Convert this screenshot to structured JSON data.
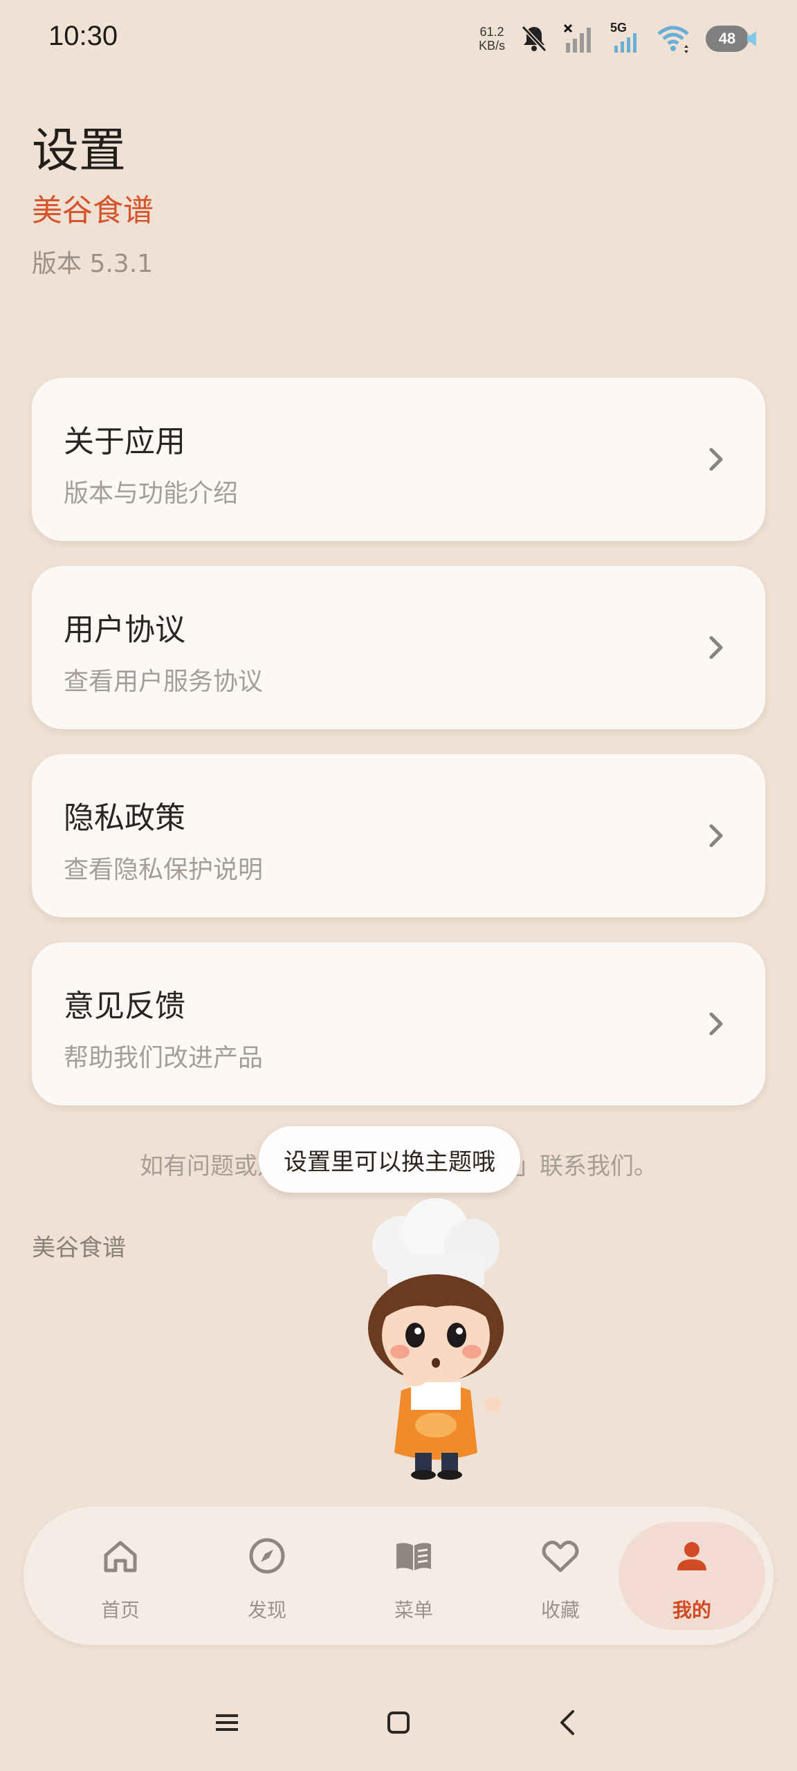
{
  "status_bar": {
    "time": "10:30",
    "net_speed_value": "61.2",
    "net_speed_unit": "KB/s",
    "network_type": "5G",
    "battery": "48",
    "icons": [
      "mute-bell-icon",
      "signal-no-service-icon",
      "signal-5g-icon",
      "wifi-icon",
      "battery-icon"
    ]
  },
  "header": {
    "title": "设置",
    "app_name": "美谷食谱",
    "version": "版本 5.3.1"
  },
  "menu": {
    "items": [
      {
        "title": "关于应用",
        "subtitle": "版本与功能介绍"
      },
      {
        "title": "用户协议",
        "subtitle": "查看用户服务协议"
      },
      {
        "title": "隐私政策",
        "subtitle": "查看隐私保护说明"
      },
      {
        "title": "意见反馈",
        "subtitle": "帮助我们改进产品"
      }
    ]
  },
  "footer": {
    "contact_text": "如有问题或建议，请通过「意见反馈」联系我们。",
    "tooltip": "设置里可以换主题哦",
    "brand": "美谷食谱"
  },
  "bottom_nav": {
    "items": [
      {
        "label": "首页",
        "icon": "home-icon"
      },
      {
        "label": "发现",
        "icon": "compass-icon"
      },
      {
        "label": "菜单",
        "icon": "book-icon"
      },
      {
        "label": "收藏",
        "icon": "heart-icon"
      },
      {
        "label": "我的",
        "icon": "person-icon"
      }
    ],
    "active_index": 4
  },
  "colors": {
    "background": "#efe1d4",
    "accent": "#d5542c",
    "card": "#fcf8f5",
    "active_tab_bg": "#f2dbd0"
  }
}
